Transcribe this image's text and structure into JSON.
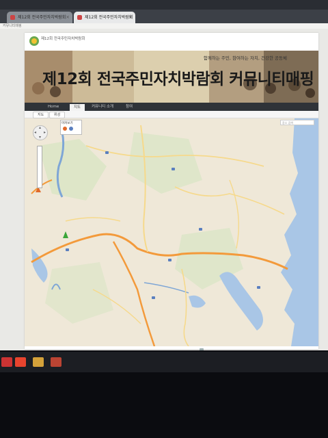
{
  "browser": {
    "tabs": [
      {
        "label": "제12회 전국주민자치박람회",
        "active": false
      },
      {
        "label": "제12회 전국주민자치박람회",
        "active": true
      }
    ],
    "address": "커뮤니티매핑"
  },
  "site": {
    "logo_text": "제12회 전국주민자치박람회",
    "title": "제12회 전국주민자치박람회 커뮤니티매핑",
    "slogan": "함께하는 주민, 참여하는 자치, 건강한 공동체",
    "nav": [
      {
        "label": "Home",
        "active": false
      },
      {
        "label": "지도",
        "active": true
      },
      {
        "label": "커뮤니티 소개",
        "active": false
      },
      {
        "label": "참여",
        "active": false
      }
    ],
    "subtabs": [
      "지도",
      "위성"
    ]
  },
  "map": {
    "search_placeholder": "장소 검색",
    "layer_box_title": "마커보기",
    "colors": {
      "land": "#efe8d8",
      "water": "#a9c6e6",
      "highway": "#f39a3b",
      "road": "#f6d98b",
      "forest": "#d9e5c4"
    }
  },
  "taskbar": {
    "icons": [
      "start-icon",
      "browser-icon",
      "folder-icon",
      "media-icon"
    ]
  }
}
